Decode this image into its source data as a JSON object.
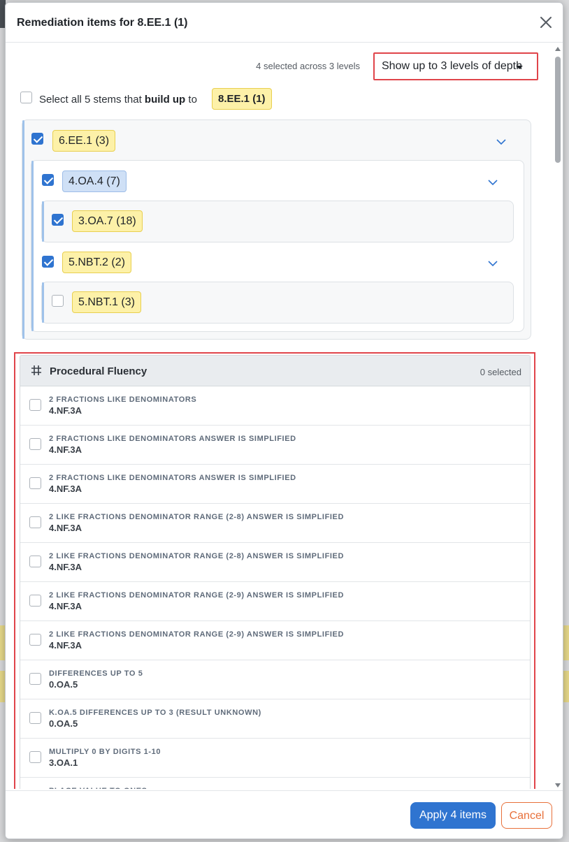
{
  "modal": {
    "title": "Remediation items for 8.EE.1 (1)"
  },
  "toolbar": {
    "selected_summary": "4 selected across 3 levels",
    "depth_dropdown_label": "Show up to 3 levels of depth"
  },
  "select_all": {
    "prefix": "Select all 5 stems that ",
    "bold": "build up",
    "suffix": " to",
    "target_badge": "8.EE.1 (1)"
  },
  "tree": {
    "level1": {
      "label": "6.EE.1 (3)",
      "checked": true
    },
    "level2a": {
      "label": "4.OA.4 (7)",
      "checked": true
    },
    "level3a": {
      "label": "3.OA.7 (18)",
      "checked": true
    },
    "level2b": {
      "label": "5.NBT.2 (2)",
      "checked": true
    },
    "level3b": {
      "label": "5.NBT.1 (3)",
      "checked": false
    }
  },
  "procedural_fluency": {
    "title": "Procedural Fluency",
    "count": "0 selected",
    "items": [
      {
        "title": "2 fractions like denominators",
        "code": "4.NF.3A"
      },
      {
        "title": "2 fractions like denominators answer is simplified",
        "code": "4.NF.3A"
      },
      {
        "title": "2 fractions like denominators answer is simplified",
        "code": "4.NF.3A"
      },
      {
        "title": "2 like fractions denominator range (2-8) answer is simplified",
        "code": "4.NF.3A"
      },
      {
        "title": "2 like fractions denominator range (2-8) answer is simplified",
        "code": "4.NF.3A"
      },
      {
        "title": "2 like fractions denominator range (2-9) answer is simplified",
        "code": "4.NF.3A"
      },
      {
        "title": "2 like fractions denominator range (2-9) answer is simplified",
        "code": "4.NF.3A"
      },
      {
        "title": "Differences up to 5",
        "code": "0.OA.5"
      },
      {
        "title": "K.OA.5 differences up to 3 (result unknown)",
        "code": "0.OA.5"
      },
      {
        "title": "Multiply 0 by digits 1-10",
        "code": "3.OA.1"
      },
      {
        "title": "Place value to ones",
        "code": ""
      }
    ]
  },
  "footer": {
    "apply_label": "Apply 4 items",
    "cancel_label": "Cancel"
  },
  "colors": {
    "primary": "#2f74d0",
    "cancel": "#e8703a",
    "highlight": "#e0444a",
    "badge_yellow": "#fdf1a8",
    "badge_blue": "#cfe0f6"
  }
}
